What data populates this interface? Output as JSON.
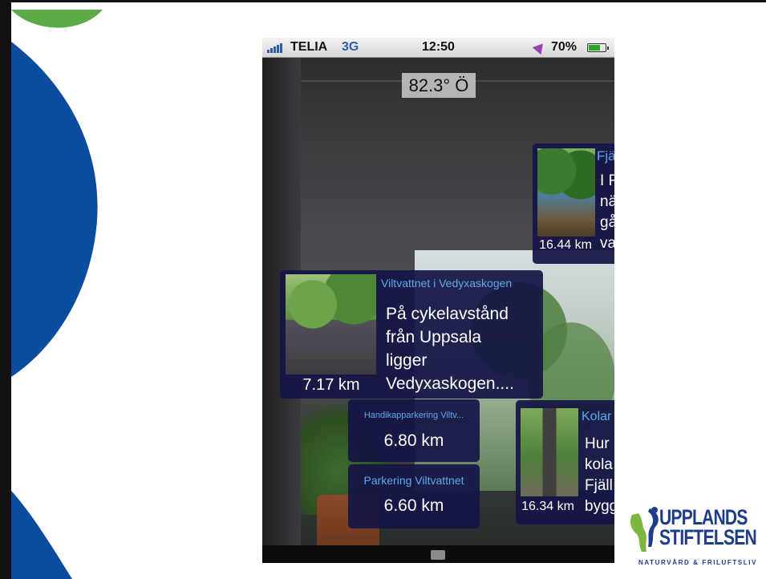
{
  "status_bar": {
    "carrier": "TELIA",
    "network": "3G",
    "time": "12:50",
    "battery_percent": "70%",
    "battery_level": 0.7
  },
  "compass_heading": "82.3° Ö",
  "cards": {
    "fjall": {
      "title": "Fjä",
      "lines": [
        "I F",
        "nä",
        "gå",
        "va"
      ],
      "distance": "16.44 km"
    },
    "viltvattnet": {
      "title": "Viltvattnet i Vedyxaskogen",
      "lines": [
        "På cykelavstånd",
        "från Uppsala",
        "ligger",
        "Vedyxaskogen...."
      ],
      "distance": "7.17 km"
    },
    "handikapp": {
      "title": "Handikapparkering Viltv...",
      "distance": "6.80 km"
    },
    "parkering": {
      "title": "Parkering Viltvattnet",
      "distance": "6.60 km"
    },
    "kolar": {
      "title": "Kolar",
      "lines": [
        "Hur",
        "kola",
        "Fjäll",
        "bygg"
      ],
      "distance": "16.34 km"
    }
  },
  "logo": {
    "line1": "UPPLANDS",
    "line2": "STIFTELSEN",
    "tagline": "NATURVÅRD & FRILUFTSLIV"
  },
  "colors": {
    "slide_blue": "#0a4d9e",
    "slide_green": "#5aab46",
    "card_bg": "#14164a",
    "card_title": "#5ea8ea",
    "logo_blue": "#1f3c8a",
    "logo_green": "#7cb83f"
  }
}
